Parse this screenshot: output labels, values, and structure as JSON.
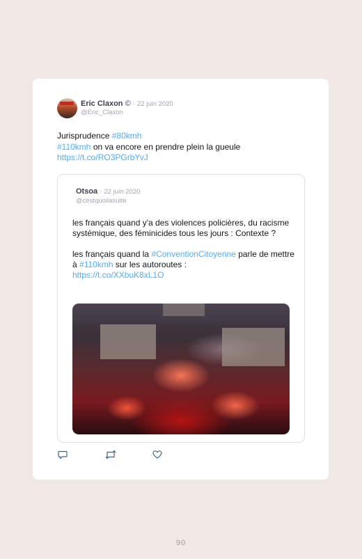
{
  "tweet": {
    "author_name": "Eric Claxon",
    "author_badge": "©",
    "date": "22 juin 2020",
    "handle": "@Eric_Claxon",
    "text_line1_plain": "Jurisprudence",
    "text_line1_tag": "#80kmh",
    "text_line2_tag": "#110kmh",
    "text_line2_plain": "on va encore en prendre plein la gueule",
    "text_line3_link": "https://t.co/RO3PGrbYvJ"
  },
  "quoted": {
    "author_name": "Otsoa",
    "date": "22 juin 2020",
    "handle": "@cestquoilasuite",
    "para1": "les français quand y'a des violences policières, du racisme systémique, des féminicides tous les jours : Contexte ?",
    "para2_before": "les français quand la",
    "para2_tag1": "#ConventionCitoyenne",
    "para2_middle1": "parle de mettre à",
    "para2_tag2": "#110kmh",
    "para2_middle2": "sur les autoroutes :",
    "para2_link": "https://t.co/XXbuK8xL1O"
  },
  "actions": {
    "reply_icon": "reply-icon",
    "retweet_icon": "retweet-icon",
    "like_icon": "heart-icon"
  },
  "page_number": "90",
  "colors": {
    "background": "#efe8e4",
    "card": "#ffffff",
    "link": "#55acee",
    "text": "#14171a",
    "muted": "#a0a6ae"
  }
}
